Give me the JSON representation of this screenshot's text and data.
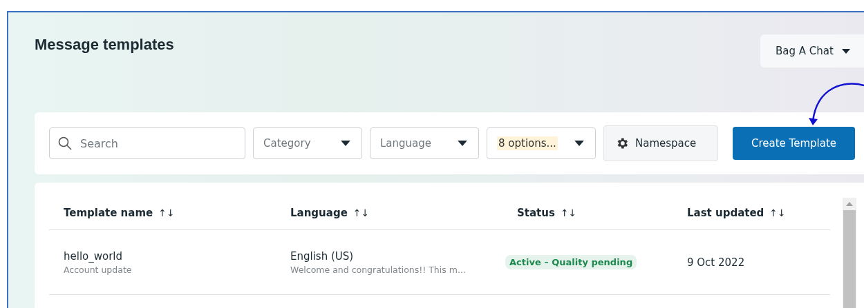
{
  "page": {
    "title": "Message templates"
  },
  "account_menu": {
    "label": "Bag A Chat"
  },
  "toolbar": {
    "search": {
      "placeholder": "Search"
    },
    "filters": [
      {
        "label": "Category",
        "highlighted": false
      },
      {
        "label": "Language",
        "highlighted": false
      },
      {
        "label": "8 options...",
        "highlighted": true
      }
    ],
    "namespace_button": "Namespace",
    "create_button": "Create Template"
  },
  "table": {
    "columns": [
      "Template name",
      "Language",
      "Status",
      "Last updated"
    ],
    "sort_icon": "↑↓",
    "rows": [
      {
        "name": "hello_world",
        "category": "Account update",
        "language": "English (US)",
        "preview": "Welcome and congratulations!! This m...",
        "status": "Active – Quality pending",
        "color": "#1c8a4e",
        "last_updated": "9 Oct 2022"
      }
    ]
  }
}
